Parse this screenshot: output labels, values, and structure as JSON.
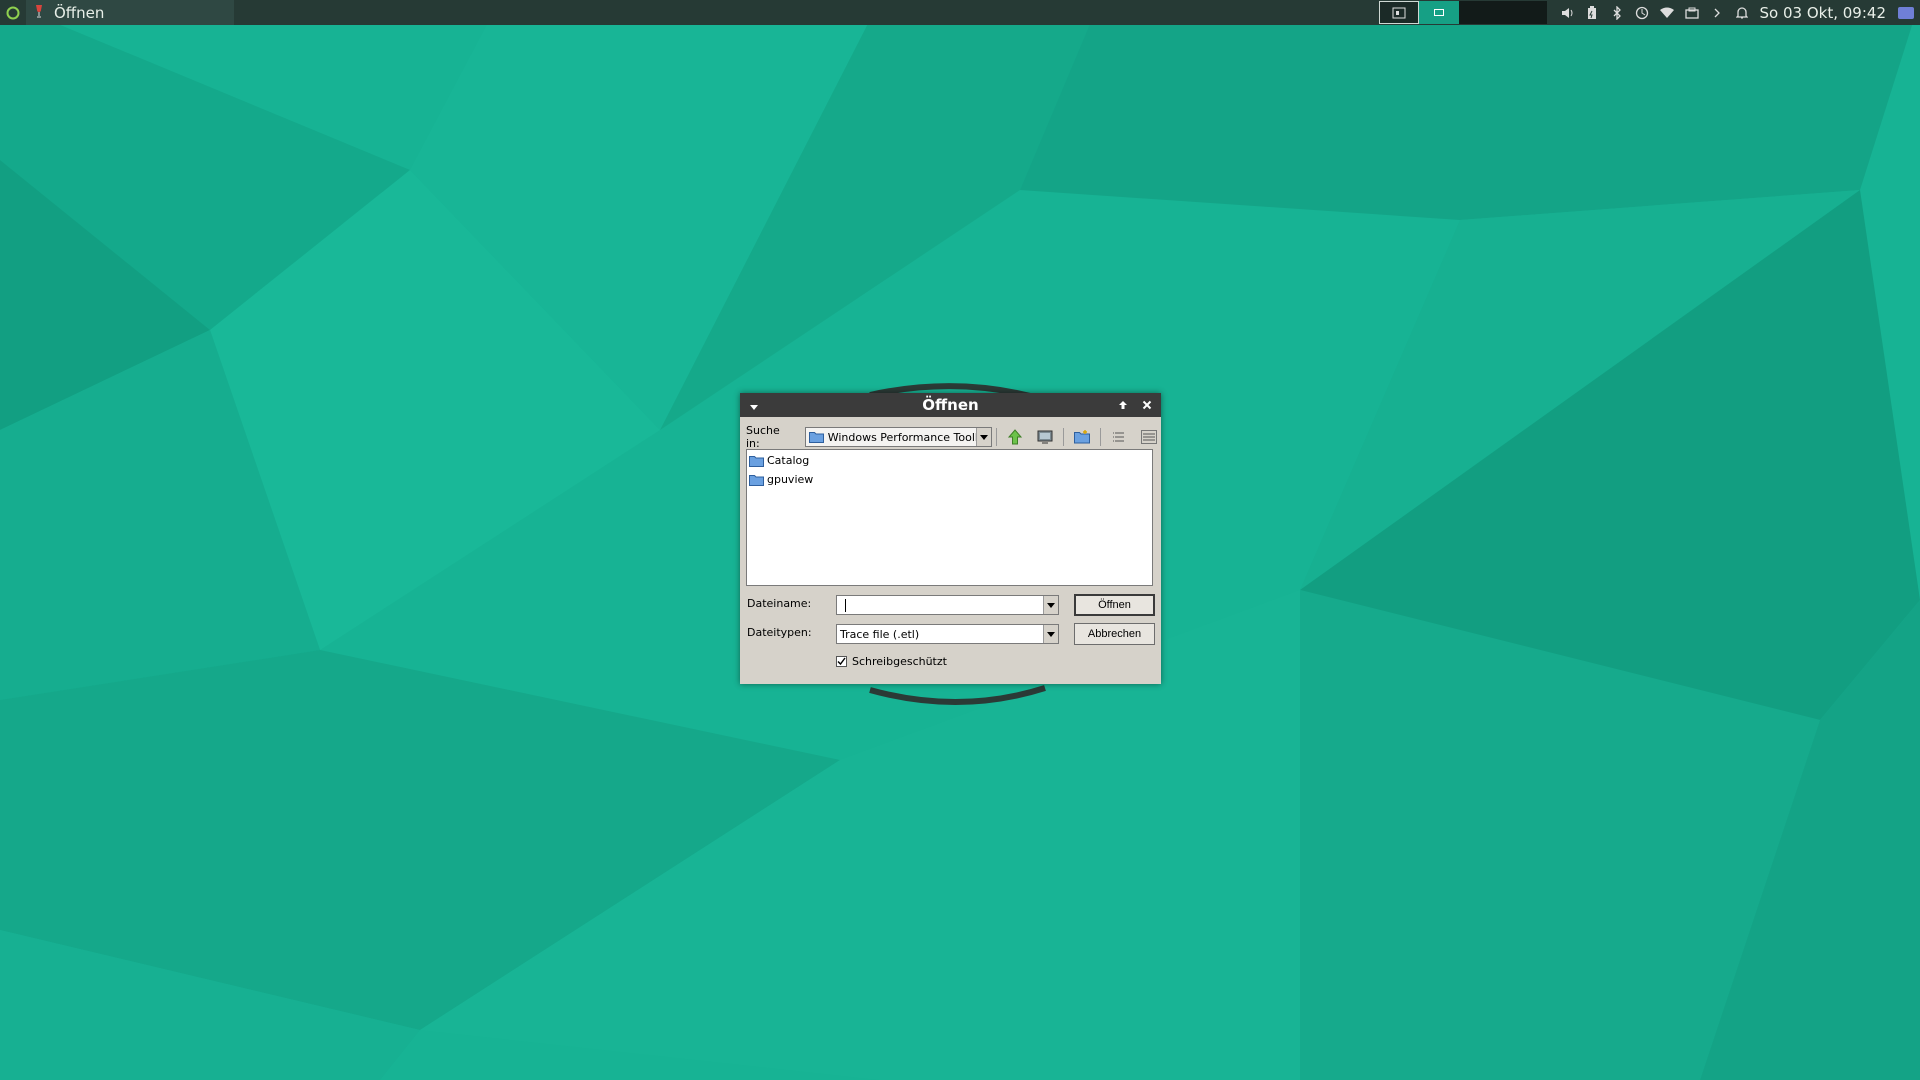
{
  "panel": {
    "task_title": "Öffnen",
    "clock": "So 03 Okt, 09:42",
    "icons": [
      "app-menu-icon",
      "wine-glass-icon",
      "volume-icon",
      "battery-icon",
      "bluetooth-icon",
      "update-icon",
      "wifi-icon",
      "clipboard-icon",
      "chevron-right-icon",
      "bell-icon",
      "keyboard-layout-icon"
    ]
  },
  "dialog": {
    "title": "Öffnen",
    "look_in_label": "Suche in:",
    "look_in_value": "Windows Performance Toolkit",
    "files": [
      {
        "name": "Catalog",
        "icon": "folder-icon"
      },
      {
        "name": "gpuview",
        "icon": "folder-icon"
      }
    ],
    "filename_label": "Dateiname:",
    "filename_value": "",
    "filetype_label": "Dateitypen:",
    "filetype_value": "Trace file (.etl)",
    "open_button": "Öffnen",
    "cancel_button": "Abbrechen",
    "readonly_label": "Schreibgeschützt",
    "readonly_checked": true
  },
  "colors": {
    "desktop": "#17b394",
    "panel": "#263a35",
    "titlebar": "#3b3b3b",
    "dialog": "#d6d2ca"
  }
}
